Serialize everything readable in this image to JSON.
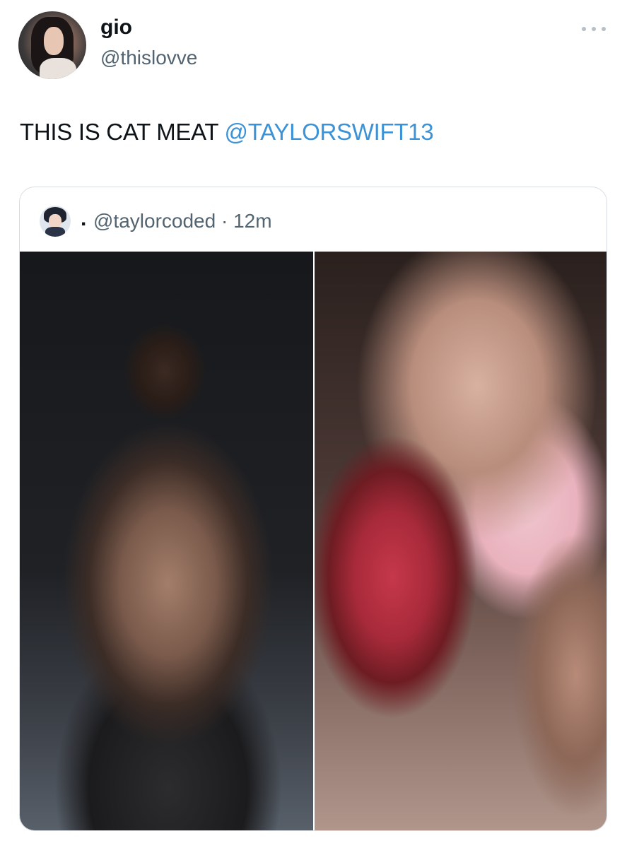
{
  "tweet": {
    "display_name": "gio",
    "handle": "@thislovve",
    "text_plain": "THIS IS CAT MEAT ",
    "text_mention": "@TAYLORSWIFT13"
  },
  "quoted_tweet": {
    "name": ".",
    "handle_time": "@taylorcoded · 12m"
  },
  "icons": {
    "more": "more-horizontal-icon"
  },
  "colors": {
    "mention": "#3b92d7",
    "handle": "#536471",
    "border": "#d7dde2"
  }
}
